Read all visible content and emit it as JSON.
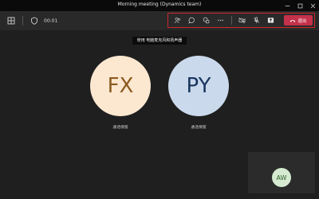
{
  "window": {
    "title": "Morning meeting (Dynamics team)"
  },
  "toolbar": {
    "timer": "00:01",
    "left_icons": [
      "grid-icon",
      "shield-icon"
    ],
    "actions": [
      "people-icon",
      "chat-icon",
      "react-icon",
      "more-icon",
      "camera-off-icon",
      "mic-off-icon",
      "share-tray-icon"
    ],
    "leave_label": "退出",
    "leave_color": "#c4314b"
  },
  "tooltip": {
    "text": "使用 电脑麦克风和扬声器"
  },
  "participants": [
    {
      "initials": "FX",
      "label": "通话保留",
      "color": "#fce7d0",
      "text_color": "#8a5a20"
    },
    {
      "initials": "PY",
      "label": "通话保留",
      "color": "#cbd9ec",
      "text_color": "#18365e"
    }
  ],
  "self": {
    "initials": "AW",
    "color": "#d5ead0"
  }
}
